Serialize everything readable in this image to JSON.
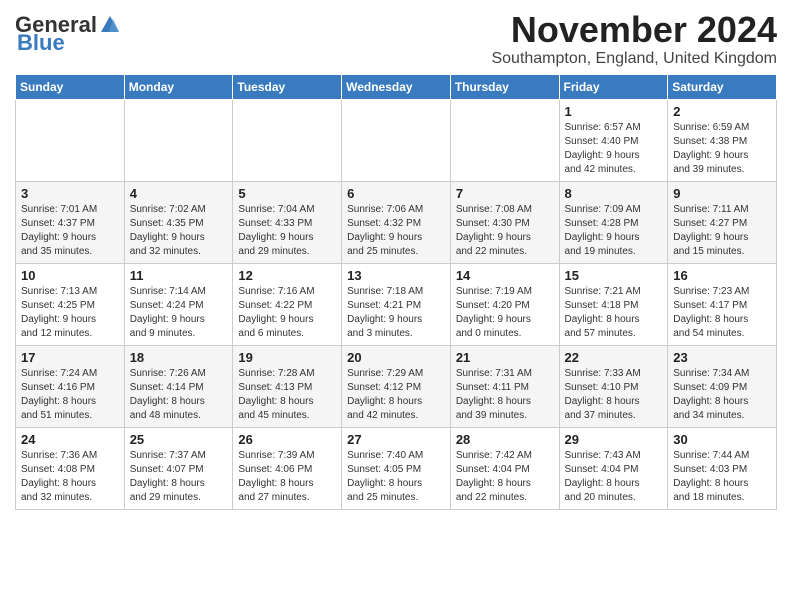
{
  "header": {
    "logo_general": "General",
    "logo_blue": "Blue",
    "month": "November 2024",
    "location": "Southampton, England, United Kingdom"
  },
  "weekdays": [
    "Sunday",
    "Monday",
    "Tuesday",
    "Wednesday",
    "Thursday",
    "Friday",
    "Saturday"
  ],
  "weeks": [
    [
      {
        "day": "",
        "info": ""
      },
      {
        "day": "",
        "info": ""
      },
      {
        "day": "",
        "info": ""
      },
      {
        "day": "",
        "info": ""
      },
      {
        "day": "",
        "info": ""
      },
      {
        "day": "1",
        "info": "Sunrise: 6:57 AM\nSunset: 4:40 PM\nDaylight: 9 hours\nand 42 minutes."
      },
      {
        "day": "2",
        "info": "Sunrise: 6:59 AM\nSunset: 4:38 PM\nDaylight: 9 hours\nand 39 minutes."
      }
    ],
    [
      {
        "day": "3",
        "info": "Sunrise: 7:01 AM\nSunset: 4:37 PM\nDaylight: 9 hours\nand 35 minutes."
      },
      {
        "day": "4",
        "info": "Sunrise: 7:02 AM\nSunset: 4:35 PM\nDaylight: 9 hours\nand 32 minutes."
      },
      {
        "day": "5",
        "info": "Sunrise: 7:04 AM\nSunset: 4:33 PM\nDaylight: 9 hours\nand 29 minutes."
      },
      {
        "day": "6",
        "info": "Sunrise: 7:06 AM\nSunset: 4:32 PM\nDaylight: 9 hours\nand 25 minutes."
      },
      {
        "day": "7",
        "info": "Sunrise: 7:08 AM\nSunset: 4:30 PM\nDaylight: 9 hours\nand 22 minutes."
      },
      {
        "day": "8",
        "info": "Sunrise: 7:09 AM\nSunset: 4:28 PM\nDaylight: 9 hours\nand 19 minutes."
      },
      {
        "day": "9",
        "info": "Sunrise: 7:11 AM\nSunset: 4:27 PM\nDaylight: 9 hours\nand 15 minutes."
      }
    ],
    [
      {
        "day": "10",
        "info": "Sunrise: 7:13 AM\nSunset: 4:25 PM\nDaylight: 9 hours\nand 12 minutes."
      },
      {
        "day": "11",
        "info": "Sunrise: 7:14 AM\nSunset: 4:24 PM\nDaylight: 9 hours\nand 9 minutes."
      },
      {
        "day": "12",
        "info": "Sunrise: 7:16 AM\nSunset: 4:22 PM\nDaylight: 9 hours\nand 6 minutes."
      },
      {
        "day": "13",
        "info": "Sunrise: 7:18 AM\nSunset: 4:21 PM\nDaylight: 9 hours\nand 3 minutes."
      },
      {
        "day": "14",
        "info": "Sunrise: 7:19 AM\nSunset: 4:20 PM\nDaylight: 9 hours\nand 0 minutes."
      },
      {
        "day": "15",
        "info": "Sunrise: 7:21 AM\nSunset: 4:18 PM\nDaylight: 8 hours\nand 57 minutes."
      },
      {
        "day": "16",
        "info": "Sunrise: 7:23 AM\nSunset: 4:17 PM\nDaylight: 8 hours\nand 54 minutes."
      }
    ],
    [
      {
        "day": "17",
        "info": "Sunrise: 7:24 AM\nSunset: 4:16 PM\nDaylight: 8 hours\nand 51 minutes."
      },
      {
        "day": "18",
        "info": "Sunrise: 7:26 AM\nSunset: 4:14 PM\nDaylight: 8 hours\nand 48 minutes."
      },
      {
        "day": "19",
        "info": "Sunrise: 7:28 AM\nSunset: 4:13 PM\nDaylight: 8 hours\nand 45 minutes."
      },
      {
        "day": "20",
        "info": "Sunrise: 7:29 AM\nSunset: 4:12 PM\nDaylight: 8 hours\nand 42 minutes."
      },
      {
        "day": "21",
        "info": "Sunrise: 7:31 AM\nSunset: 4:11 PM\nDaylight: 8 hours\nand 39 minutes."
      },
      {
        "day": "22",
        "info": "Sunrise: 7:33 AM\nSunset: 4:10 PM\nDaylight: 8 hours\nand 37 minutes."
      },
      {
        "day": "23",
        "info": "Sunrise: 7:34 AM\nSunset: 4:09 PM\nDaylight: 8 hours\nand 34 minutes."
      }
    ],
    [
      {
        "day": "24",
        "info": "Sunrise: 7:36 AM\nSunset: 4:08 PM\nDaylight: 8 hours\nand 32 minutes."
      },
      {
        "day": "25",
        "info": "Sunrise: 7:37 AM\nSunset: 4:07 PM\nDaylight: 8 hours\nand 29 minutes."
      },
      {
        "day": "26",
        "info": "Sunrise: 7:39 AM\nSunset: 4:06 PM\nDaylight: 8 hours\nand 27 minutes."
      },
      {
        "day": "27",
        "info": "Sunrise: 7:40 AM\nSunset: 4:05 PM\nDaylight: 8 hours\nand 25 minutes."
      },
      {
        "day": "28",
        "info": "Sunrise: 7:42 AM\nSunset: 4:04 PM\nDaylight: 8 hours\nand 22 minutes."
      },
      {
        "day": "29",
        "info": "Sunrise: 7:43 AM\nSunset: 4:04 PM\nDaylight: 8 hours\nand 20 minutes."
      },
      {
        "day": "30",
        "info": "Sunrise: 7:44 AM\nSunset: 4:03 PM\nDaylight: 8 hours\nand 18 minutes."
      }
    ]
  ]
}
